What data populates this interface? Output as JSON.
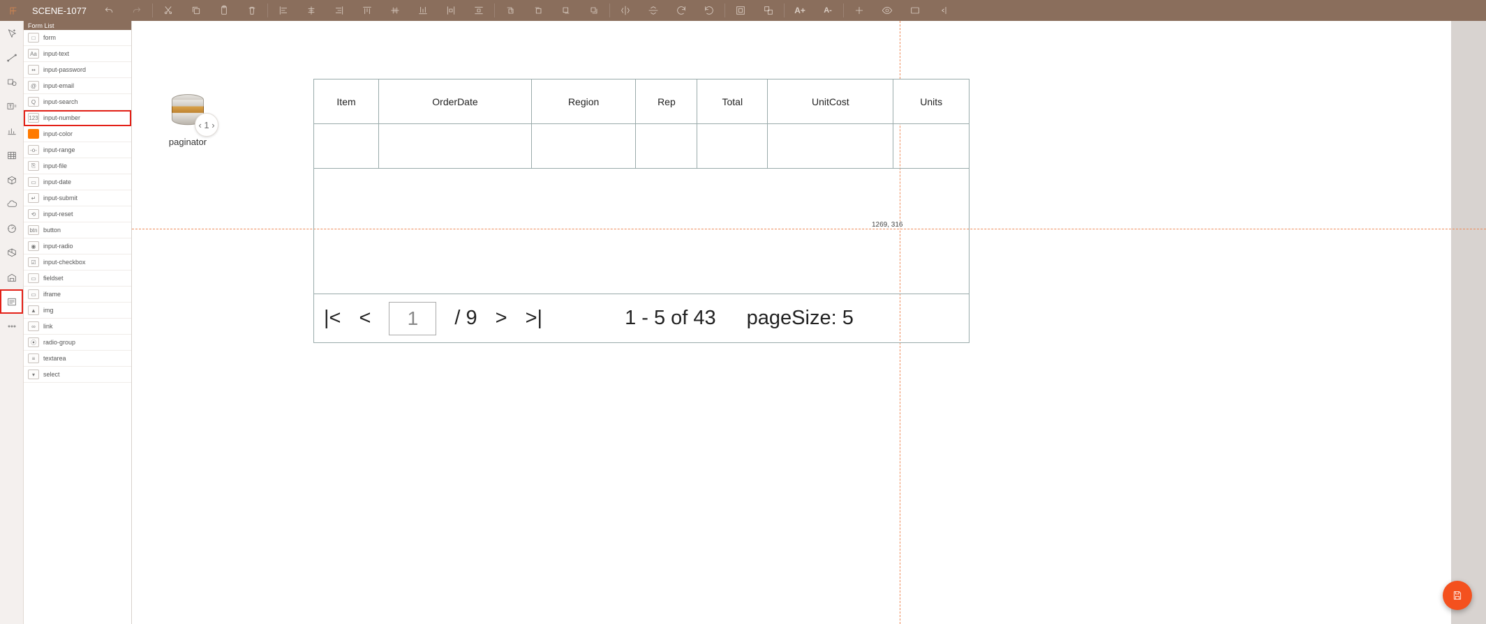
{
  "scene_name": "SCENE-1077",
  "panel": {
    "title": "Form List",
    "items": [
      {
        "label": "form",
        "icon": "□"
      },
      {
        "label": "input-text",
        "icon": "Aa"
      },
      {
        "label": "input-password",
        "icon": "••"
      },
      {
        "label": "input-email",
        "icon": "@"
      },
      {
        "label": "input-search",
        "icon": "Q"
      },
      {
        "label": "input-number",
        "icon": "123",
        "selected": true
      },
      {
        "label": "input-color",
        "icon": "",
        "color": true
      },
      {
        "label": "input-range",
        "icon": "-o-"
      },
      {
        "label": "input-file",
        "icon": "⎘"
      },
      {
        "label": "input-date",
        "icon": "▭"
      },
      {
        "label": "input-submit",
        "icon": "↵"
      },
      {
        "label": "input-reset",
        "icon": "⟲"
      },
      {
        "label": "button",
        "icon": "btn"
      },
      {
        "label": "input-radio",
        "icon": "◉"
      },
      {
        "label": "input-checkbox",
        "icon": "☑"
      },
      {
        "label": "fieldset",
        "icon": "▭"
      },
      {
        "label": "iframe",
        "icon": "▭"
      },
      {
        "label": "img",
        "icon": "▲"
      },
      {
        "label": "link",
        "icon": "∞"
      },
      {
        "label": "radio-group",
        "icon": "⦿"
      },
      {
        "label": "textarea",
        "icon": "≡"
      },
      {
        "label": "select",
        "icon": "▾"
      }
    ]
  },
  "rail_active_index": 11,
  "datasource": {
    "label": "paginator",
    "badge": "‹ 1 ›"
  },
  "table": {
    "columns": [
      "Item",
      "OrderDate",
      "Region",
      "Rep",
      "Total",
      "UnitCost",
      "Units"
    ]
  },
  "pager": {
    "first": "|<",
    "prev": "<",
    "page": "1",
    "total_pages": "/ 9",
    "next": ">",
    "last": ">|",
    "range": "1   -   5   of 43",
    "page_size": "pageSize: 5"
  },
  "guides": {
    "coord_text": "1269, 316"
  }
}
